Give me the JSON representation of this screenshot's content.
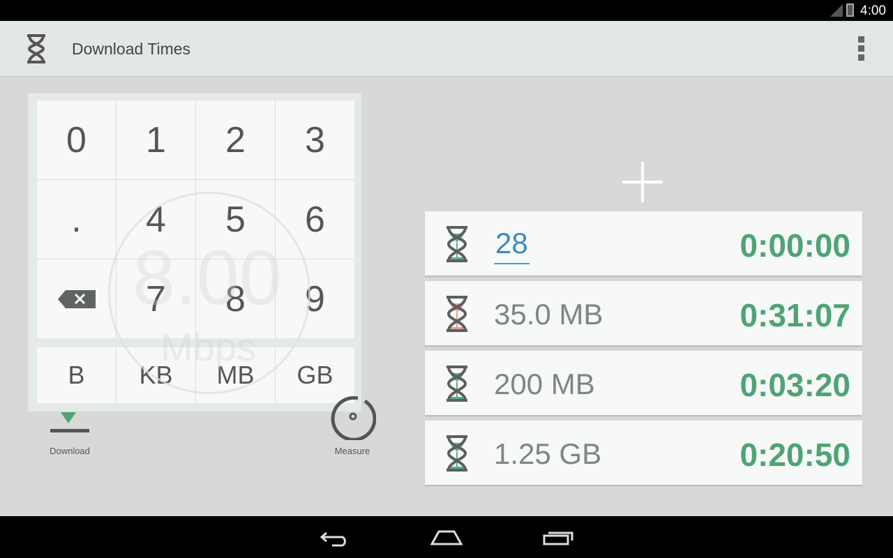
{
  "status_bar": {
    "time": "4:00"
  },
  "app_bar": {
    "title": "Download Times",
    "icon": "hourglass-icon",
    "menu_icon": "overflow-menu-icon"
  },
  "keypad": {
    "keys": [
      "0",
      "1",
      "2",
      "3",
      ".",
      "4",
      "5",
      "6",
      "backspace",
      "7",
      "8",
      "9"
    ],
    "units": [
      "B",
      "KB",
      "MB",
      "GB"
    ]
  },
  "speed_watermark": {
    "value": "8.00",
    "unit": "Mbps"
  },
  "actions": {
    "download": "Download",
    "measure": "Measure"
  },
  "add_icon": "plus-icon",
  "entries": [
    {
      "size": "28",
      "time": "0:00:00",
      "editing": true,
      "hourglass_color": "#5aae84"
    },
    {
      "size": "35.0 MB",
      "time": "0:31:07",
      "editing": false,
      "hourglass_color": "#e89b8c"
    },
    {
      "size": "200 MB",
      "time": "0:03:20",
      "editing": false,
      "hourglass_color": "#5aae84"
    },
    {
      "size": "1.25 GB",
      "time": "0:20:50",
      "editing": false,
      "hourglass_color": "#5aae84"
    }
  ],
  "colors": {
    "accent_green": "#4fa374",
    "edit_blue": "#3d8bbf",
    "warn_red": "#e89b8c"
  }
}
